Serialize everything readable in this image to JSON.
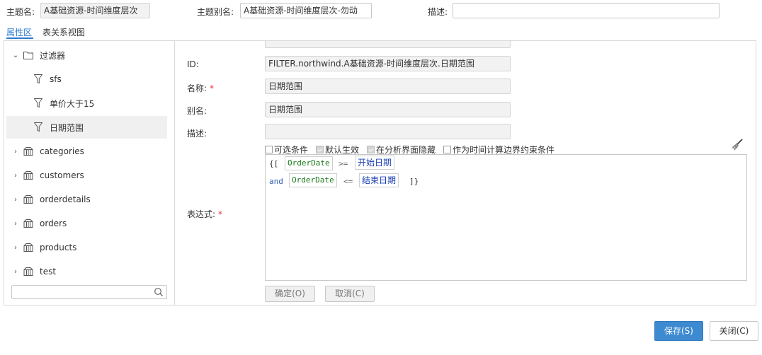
{
  "header": {
    "subject_name_label": "主题名:",
    "subject_name_value": "A基础资源-时间维度层次",
    "subject_alias_label": "主题别名:",
    "subject_alias_value": "A基础资源-时间维度层次-勿动",
    "description_label": "描述:",
    "description_value": ""
  },
  "tabs": [
    {
      "label": "属性区",
      "active": true
    },
    {
      "label": "表关系视图",
      "active": false
    }
  ],
  "tree": {
    "filter_group": "过滤器",
    "filters": [
      "sfs",
      "单价大于15",
      "日期范围"
    ],
    "selected": "日期范围",
    "tables": [
      "categories",
      "customers",
      "orderdetails",
      "orders",
      "products",
      "test"
    ],
    "search_placeholder": ""
  },
  "form": {
    "id_label": "ID:",
    "id_value": "FILTER.northwind.A基础资源-时间维度层次.日期范围",
    "name_label": "名称:",
    "name_value": "日期范围",
    "alias_label": "别名:",
    "alias_value": "日期范围",
    "desc_label": "描述:",
    "desc_value": "",
    "required_mark": "*",
    "expression_label": "表达式:",
    "options": [
      {
        "label": "可选条件",
        "checked": false
      },
      {
        "label": "默认生效",
        "checked": true
      },
      {
        "label": "在分析界面隐藏",
        "checked": true
      },
      {
        "label": "作为时间计算边界约束条件",
        "checked": false
      }
    ],
    "expression": {
      "open": "{[",
      "field1": "OrderDate",
      "op1": ">=",
      "param1": "开始日期",
      "and": "and",
      "field2": "OrderDate",
      "op2": "<=",
      "param2": "结束日期",
      "close": "]}"
    },
    "ok_button": "确定(O)",
    "cancel_button": "取消(C)"
  },
  "footer": {
    "save_button": "保存(S)",
    "close_button": "关闭(C)"
  },
  "colors": {
    "accent": "#2f7bd1",
    "primary_button": "#3d8ad1"
  }
}
